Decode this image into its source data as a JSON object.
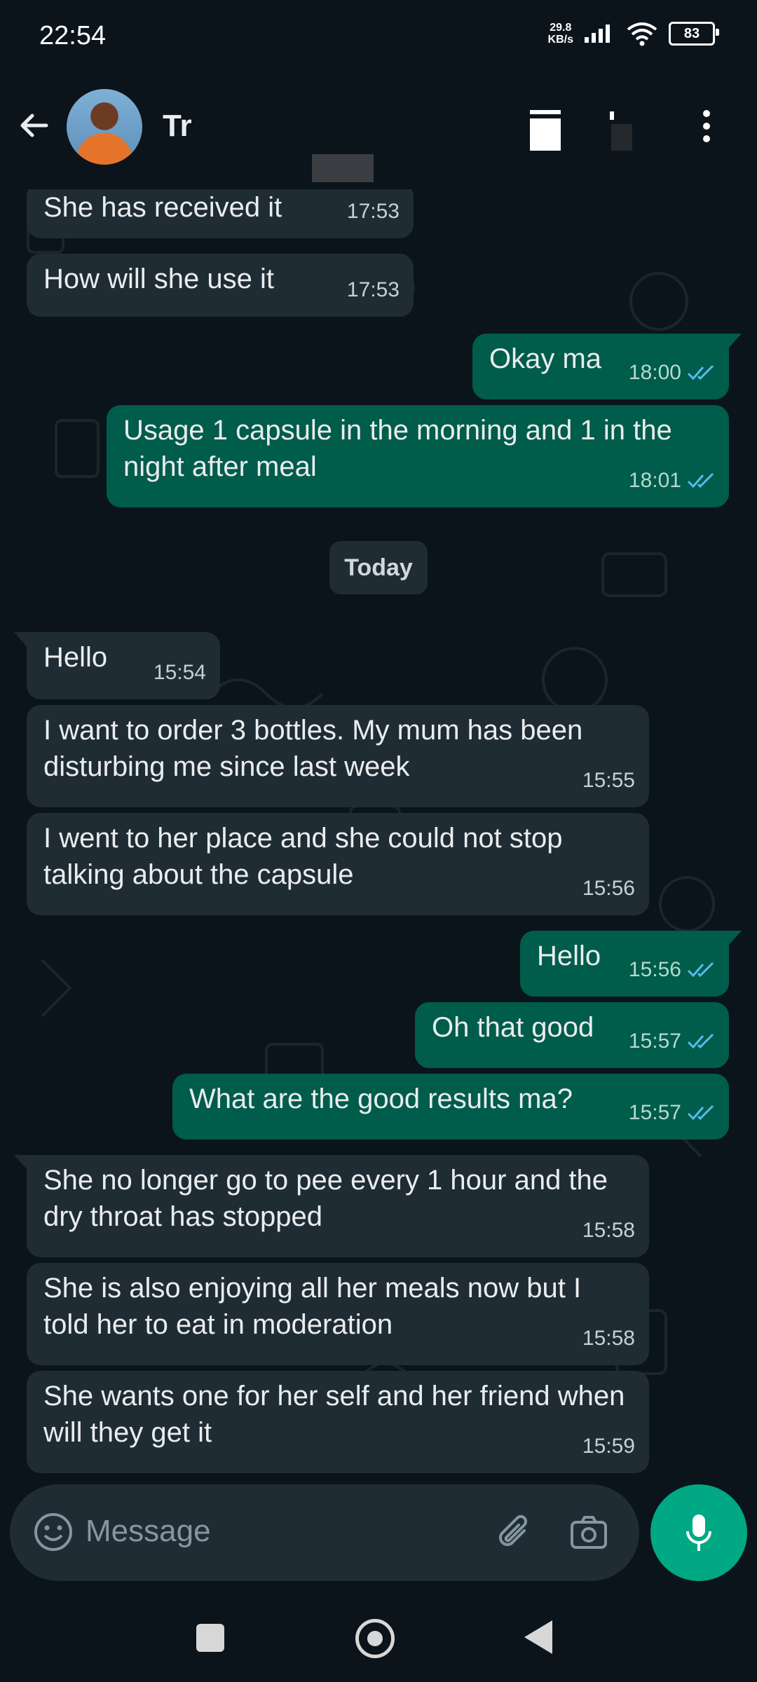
{
  "status": {
    "time": "22:54",
    "net_speed_value": "29.8",
    "net_speed_unit": "KB/s",
    "battery": "83"
  },
  "header": {
    "contact_name": "Tr"
  },
  "chat": {
    "day_label": "Today",
    "messages": [
      {
        "dir": "in",
        "text": "She has received it",
        "time": "17:53"
      },
      {
        "dir": "in",
        "text": "How will she use it",
        "time": "17:53"
      },
      {
        "dir": "out",
        "text": "Okay ma",
        "time": "18:00",
        "status": "read"
      },
      {
        "dir": "out",
        "text": "Usage 1 capsule in the morning and 1 in the night after meal",
        "time": "18:01",
        "status": "read"
      },
      {
        "dir": "in",
        "text": "Hello",
        "time": "15:54"
      },
      {
        "dir": "in",
        "text": "I want to order 3 bottles. My mum has been disturbing me since last week",
        "time": "15:55"
      },
      {
        "dir": "in",
        "text": "I went to her place and she could not stop talking about the capsule",
        "time": "15:56"
      },
      {
        "dir": "out",
        "text": "Hello",
        "time": "15:56",
        "status": "read"
      },
      {
        "dir": "out",
        "text": "Oh that good",
        "time": "15:57",
        "status": "read"
      },
      {
        "dir": "out",
        "text": "What are the good results ma?",
        "time": "15:57",
        "status": "read"
      },
      {
        "dir": "in",
        "text": "She no longer go to pee every 1 hour and the dry throat has stopped",
        "time": "15:58"
      },
      {
        "dir": "in",
        "text": "She is also enjoying all her meals now but I told her to eat in moderation",
        "time": "15:58"
      },
      {
        "dir": "in",
        "text": "She wants one for her self and her friend when will they get it",
        "time": "15:59"
      }
    ]
  },
  "composer": {
    "placeholder": "Message"
  },
  "colors": {
    "background": "#0b141a",
    "incoming_bubble": "#202c33",
    "outgoing_bubble": "#005c4b",
    "accent": "#00a884",
    "read_tick": "#53bdeb"
  },
  "icons": {
    "back": "arrow-left-icon",
    "call": "call-icon",
    "menu": "more-vertical-icon",
    "emoji": "emoji-icon",
    "attach": "paperclip-icon",
    "camera": "camera-icon",
    "mic": "microphone-icon"
  }
}
